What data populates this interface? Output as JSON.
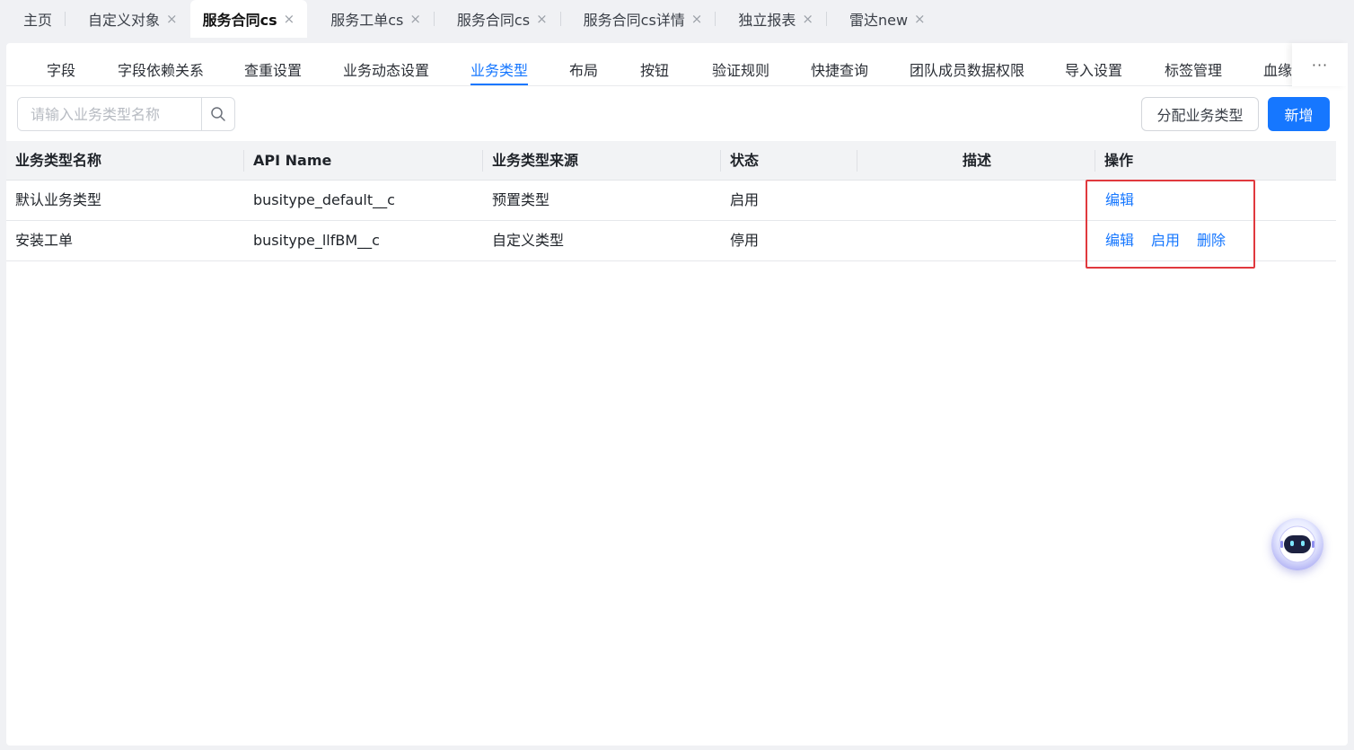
{
  "tabs": [
    {
      "label": "主页",
      "closable": false,
      "active": false
    },
    {
      "label": "自定义对象",
      "closable": true,
      "active": false
    },
    {
      "label": "服务合同cs",
      "closable": true,
      "active": true
    },
    {
      "label": "服务工单cs",
      "closable": true,
      "active": false
    },
    {
      "label": "服务合同cs",
      "closable": true,
      "active": false
    },
    {
      "label": "服务合同cs详情",
      "closable": true,
      "active": false
    },
    {
      "label": "独立报表",
      "closable": true,
      "active": false
    },
    {
      "label": "雷达new",
      "closable": true,
      "active": false
    }
  ],
  "close_glyph": "×",
  "subtabs": [
    "字段",
    "字段依赖关系",
    "查重设置",
    "业务动态设置",
    "业务类型",
    "布局",
    "按钮",
    "验证规则",
    "快捷查询",
    "团队成员数据权限",
    "导入设置",
    "标签管理",
    "血缘"
  ],
  "active_subtab": "业务类型",
  "more_label": "···",
  "toolbar": {
    "search_placeholder": "请输入业务类型名称",
    "assign_label": "分配业务类型",
    "new_label": "新增"
  },
  "table": {
    "headers": {
      "name": "业务类型名称",
      "api": "API Name",
      "source": "业务类型来源",
      "status": "状态",
      "desc": "描述",
      "ops": "操作"
    },
    "rows": [
      {
        "name": "默认业务类型",
        "api": "busitype_default__c",
        "source": "预置类型",
        "status": "启用",
        "desc": "",
        "actions": [
          "编辑"
        ]
      },
      {
        "name": "安装工单",
        "api": "busitype_llfBM__c",
        "source": "自定义类型",
        "status": "停用",
        "desc": "",
        "actions": [
          "编辑",
          "启用",
          "删除"
        ]
      }
    ]
  },
  "colors": {
    "accent": "#1677ff",
    "highlight": "#e0393e"
  },
  "icons": {
    "search": "search-icon",
    "assistant": "robot-assistant-icon"
  }
}
